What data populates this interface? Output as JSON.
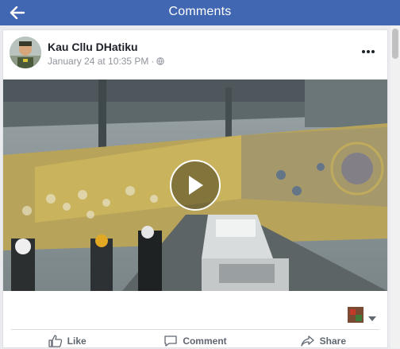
{
  "topbar": {
    "title": "Comments"
  },
  "post": {
    "author": "Kau Cllu DHatiku",
    "timestamp": "January 24 at 10:35 PM",
    "separator": "·",
    "privacy_icon": "globe-icon"
  },
  "actions": {
    "like_label": "Like",
    "comment_label": "Comment",
    "share_label": "Share"
  },
  "colors": {
    "brand": "#4267b2",
    "author_text": "#1d2129",
    "meta_text": "#90949c",
    "action_text": "#606770"
  }
}
